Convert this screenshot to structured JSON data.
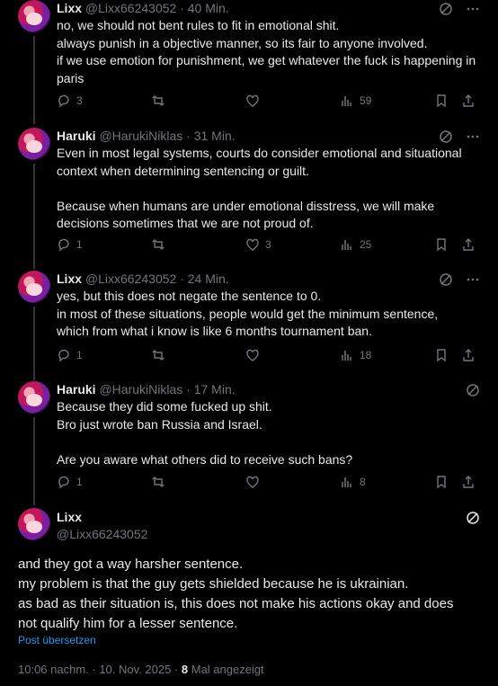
{
  "tweets": [
    {
      "name": "Lixx",
      "handle": "@Lixx66243052",
      "time": "· 40 Min.",
      "lines": [
        "no, we should not bent rules to fit in emotional shit.",
        "always punish in a objective manner, so its fair to anyone involved.",
        "if we use emotion for punishment, we get whatever the fuck is happening in",
        "paris"
      ],
      "replies": "3",
      "retweets": "",
      "likes": "",
      "views": "59"
    },
    {
      "name": "Haruki",
      "handle": "@HarukiNiklas",
      "time": "· 31 Min.",
      "lines": [
        "Even in most legal systems, courts do consider emotional and situational",
        "context when determining sentencing or guilt.",
        "",
        "Because when humans are under emotional disstress, we will make",
        "decisions sometimes that we are not proud of."
      ],
      "replies": "1",
      "retweets": "",
      "likes": "3",
      "views": "25"
    },
    {
      "name": "Lixx",
      "handle": "@Lixx66243052",
      "time": "· 24 Min.",
      "lines": [
        "yes, but this does not negate the sentence to 0.",
        "in most of these situations, people would get the minimum sentence,",
        "which from what i know is like 6 months tournament ban."
      ],
      "replies": "1",
      "retweets": "",
      "likes": "",
      "views": "18"
    },
    {
      "name": "Haruki",
      "handle": "@HarukiNiklas",
      "time": "· 17 Min.",
      "lines": [
        "Because they did some fucked up shit.",
        "Bro just wrote ban Russia and Israel.",
        "",
        "Are you aware what others did to receive such bans?"
      ],
      "replies": "1",
      "retweets": "",
      "likes": "",
      "views": "8"
    }
  ],
  "main": {
    "name": "Lixx",
    "handle": "@Lixx66243052",
    "lines": [
      "and they got a way harsher sentence.",
      "my problem is that the guy gets shielded because he is ukrainian.",
      "as bad as their situation is, this does not make his actions okay and does",
      "not qualify him for a lesser sentence."
    ],
    "translate": "Post übersetzen",
    "timestamp": "10:06 nachm. · 10. Nov. 2025 ·",
    "views_count": "8",
    "views_label": "Mal angezeigt"
  },
  "icons": [
    "grok-icon",
    "more-icon",
    "reply-icon",
    "retweet-icon",
    "like-icon",
    "views-icon",
    "bookmark-icon",
    "share-icon"
  ],
  "colors": {
    "background": "#000000",
    "text": "#e7e9ea",
    "muted": "#71767b",
    "link": "#1d9bf0",
    "line": "#333639"
  }
}
